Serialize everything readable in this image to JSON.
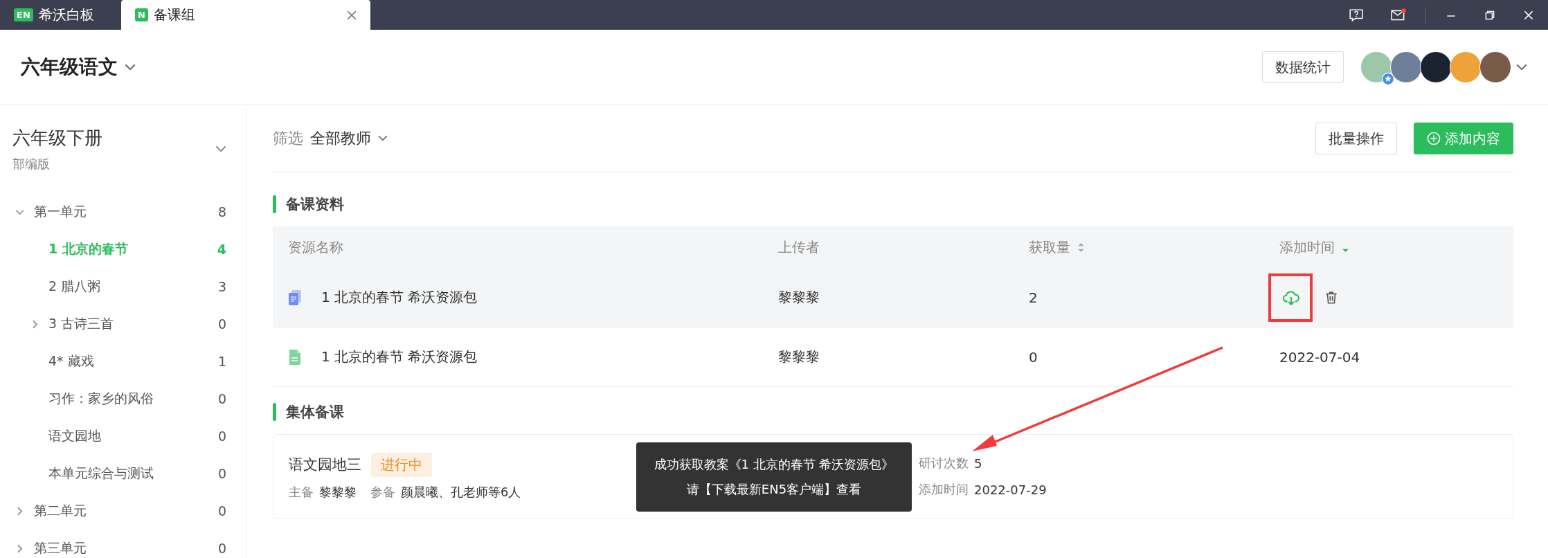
{
  "titlebar": {
    "tabs": [
      {
        "logo": "EN",
        "label": "希沃白板",
        "selected": false,
        "closable": false
      },
      {
        "logo": "N",
        "label": "备课组",
        "selected": true,
        "closable": true
      }
    ],
    "mail_unread": true
  },
  "header": {
    "title": "六年级语文",
    "stats_button": "数据统计",
    "avatars": [
      {
        "color": "#9cc7a8",
        "badge": true
      },
      {
        "color": "#6d7f99",
        "badge": false
      },
      {
        "color": "#1b2230",
        "badge": false
      },
      {
        "color": "#f0a23a",
        "badge": false
      },
      {
        "color": "#7a5a48",
        "badge": false
      }
    ]
  },
  "sidebar": {
    "book": "六年级下册",
    "edition": "部编版",
    "items": [
      {
        "label": "第一单元",
        "count": "8",
        "expanded": true,
        "selected": false,
        "children": [
          {
            "label": "1 北京的春节",
            "count": "4",
            "selected": true
          },
          {
            "label": "2 腊八粥",
            "count": "3",
            "selected": false
          },
          {
            "label": "3 古诗三首",
            "count": "0",
            "selected": false,
            "expandable": true
          },
          {
            "label": "4* 藏戏",
            "count": "1",
            "selected": false
          },
          {
            "label": "习作：家乡的风俗",
            "count": "0",
            "selected": false
          },
          {
            "label": "语文园地",
            "count": "0",
            "selected": false
          },
          {
            "label": "本单元综合与测试",
            "count": "0",
            "selected": false
          }
        ]
      },
      {
        "label": "第二单元",
        "count": "0",
        "expanded": false,
        "selected": false
      },
      {
        "label": "第三单元",
        "count": "0",
        "expanded": false,
        "selected": false
      }
    ]
  },
  "toolbar": {
    "filter_label": "筛选",
    "filter_value": "全部教师",
    "batch_button": "批量操作",
    "add_button": "添加内容"
  },
  "materials": {
    "title": "备课资料",
    "columns": [
      {
        "label": "资源名称",
        "sortable": false
      },
      {
        "label": "上传者",
        "sortable": false
      },
      {
        "label": "获取量",
        "sortable": true,
        "sorted_desc": false
      },
      {
        "label": "添加时间",
        "sortable": true,
        "sorted_desc": true
      }
    ],
    "rows": [
      {
        "kind": "package",
        "name": "1 北京的春节 希沃资源包",
        "uploader": "黎黎黎",
        "count": "2",
        "hovered": true
      },
      {
        "kind": "document",
        "name": "1 北京的春节 希沃资源包",
        "uploader": "黎黎黎",
        "count": "0",
        "date": "2022-07-04",
        "hovered": false
      }
    ]
  },
  "group": {
    "title": "集体备课",
    "cards": [
      {
        "name": "语文园地三",
        "status": "进行中",
        "lead_label": "主备",
        "lead": "黎黎黎",
        "members_label": "参备",
        "members": "颜晨曦、孔老师等6人",
        "sessions_label": "研讨次数",
        "sessions": "5",
        "date_label": "添加时间",
        "date": "2022-07-29"
      }
    ]
  },
  "toast": {
    "lines": [
      "成功获取教案《1 北京的春节 希沃资源包》",
      "请【下载最新EN5客户端】查看"
    ]
  }
}
